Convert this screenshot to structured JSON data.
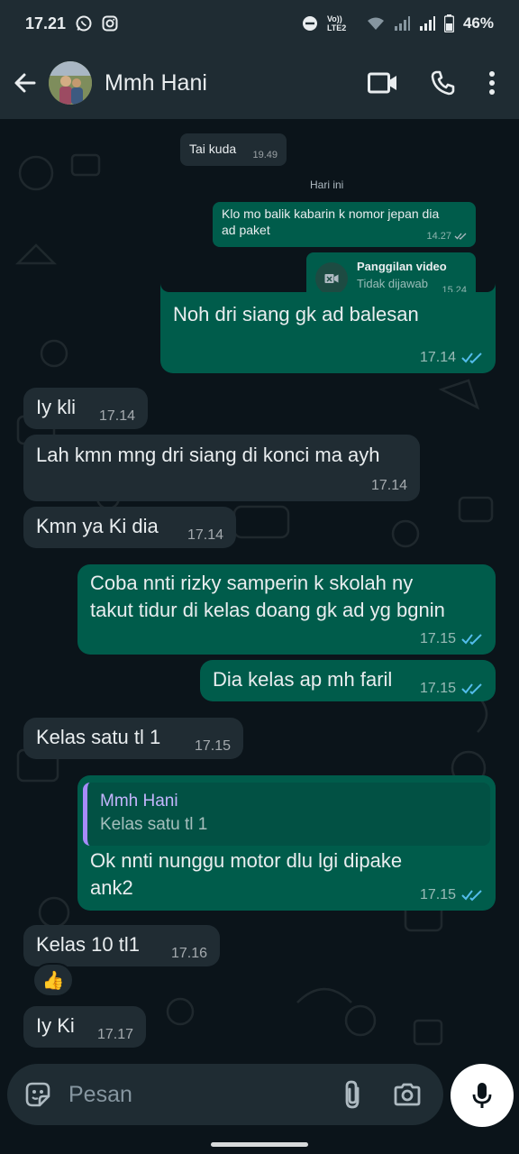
{
  "status_bar": {
    "time": "17.21",
    "network_label": "Vo)) LTE2",
    "battery": "46%"
  },
  "header": {
    "contact_name": "Mmh Hani",
    "icons": [
      "back-arrow-icon",
      "video-call-icon",
      "phone-icon",
      "more-vert-icon"
    ]
  },
  "forwarded_screenshot": {
    "msg1_text": "Tai kuda",
    "msg1_time": "19.49",
    "day_label": "Hari ini",
    "msg2_text_line1": "Klo mo balik kabarin k nomor jepan dia",
    "msg2_text_line2": "ad paket",
    "msg2_time": "14.27",
    "call_title": "Panggilan video",
    "call_status": "Tidak dijawab",
    "call_time": "15.24"
  },
  "messages": [
    {
      "dir": "out",
      "text": "Noh dri siang gk ad balesan",
      "time": "17.14"
    },
    {
      "dir": "in",
      "text": "Iy kli",
      "time": "17.14"
    },
    {
      "dir": "in",
      "text": "Lah kmn mng dri siang di konci ma ayh",
      "time": "17.14"
    },
    {
      "dir": "in",
      "text": "Kmn ya Ki dia",
      "time": "17.14"
    },
    {
      "dir": "out",
      "line1": "Coba nnti rizky samperin k skolah ny",
      "line2": "takut tidur di kelas doang gk ad yg bgnin",
      "time": "17.15"
    },
    {
      "dir": "out",
      "text": "Dia kelas ap mh faril",
      "time": "17.15"
    },
    {
      "dir": "in",
      "text": "Kelas satu tl 1",
      "time": "17.15"
    },
    {
      "dir": "out",
      "reply_name": "Mmh Hani",
      "reply_text": "Kelas satu tl 1",
      "line1": "Ok nnti nunggu motor dlu lgi dipake",
      "line2": "ank2",
      "time": "17.15"
    },
    {
      "dir": "in",
      "text": "Kelas 10 tl1",
      "time": "17.16",
      "reaction": "👍"
    },
    {
      "dir": "in",
      "text": "Iy Ki",
      "time": "17.17"
    }
  ],
  "composer": {
    "placeholder": "Pesan",
    "icons": [
      "emoji-icon",
      "attach-icon",
      "camera-icon",
      "mic-icon"
    ]
  },
  "colors": {
    "background": "#0b141a",
    "bar": "#1f2c33",
    "incoming": "#202c33",
    "outgoing": "#005c4b",
    "read_ticks": "#53bdeb"
  }
}
